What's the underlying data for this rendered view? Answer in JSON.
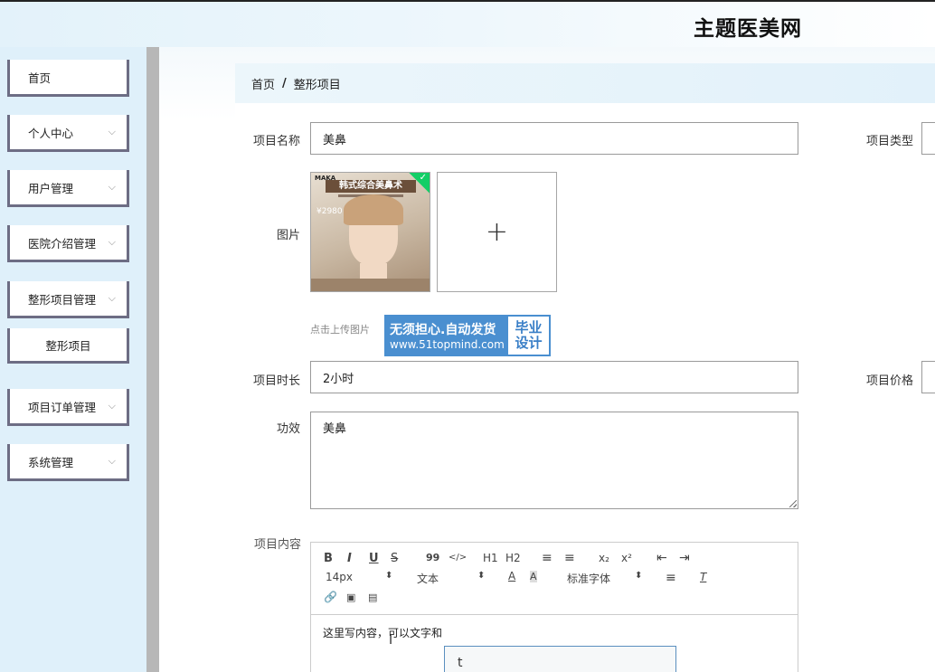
{
  "header": {
    "site_title": "主题医美网"
  },
  "sidebar": {
    "items": [
      {
        "label": "首页",
        "expandable": false
      },
      {
        "label": "个人中心",
        "expandable": true
      },
      {
        "label": "用户管理",
        "expandable": true
      },
      {
        "label": "医院介绍管理",
        "expandable": true
      },
      {
        "label": "整形项目管理",
        "expandable": true
      },
      {
        "label": "整形项目",
        "expandable": false
      },
      {
        "label": "项目订单管理",
        "expandable": true
      },
      {
        "label": "系统管理",
        "expandable": true
      }
    ],
    "chevron": "⌵"
  },
  "breadcrumb": {
    "home": "首页",
    "separator": "/",
    "current": "整形项目"
  },
  "form": {
    "name_label": "项目名称",
    "name_value": "美鼻",
    "type_label": "项目类型",
    "image_label": "图片",
    "upload_hint": "点击上传图片",
    "plus_glyph": "+",
    "duration_label": "项目时长",
    "duration_value": "2小时",
    "price_label": "项目价格",
    "effect_label": "功效",
    "effect_value": "美鼻",
    "content_label": "项目内容"
  },
  "thumbnail": {
    "brand": "MAKA",
    "headline": "韩式综合美鼻术",
    "price": "¥2980",
    "badge_icon": "check-icon"
  },
  "watermark": {
    "line1": "无须担心.自动发货",
    "line2": "www.51topmind.com",
    "right1": "毕业",
    "right2": "设计"
  },
  "editor": {
    "toolbar_row1": [
      "B",
      "I",
      "U",
      "S",
      "99",
      "</>",
      "H1",
      "H2",
      "≡",
      "≡",
      "x₂",
      "x²",
      "⇤",
      "⇥"
    ],
    "font_size": "14px",
    "text_type": "文本",
    "font_family": "标准字体",
    "content": "这里写内容，可以文字和",
    "popup_value": "t"
  },
  "colors": {
    "sidebar_bg": "#dff0fa",
    "menu_border": "#6d6d84",
    "watermark_blue": "#4a8fd0"
  }
}
